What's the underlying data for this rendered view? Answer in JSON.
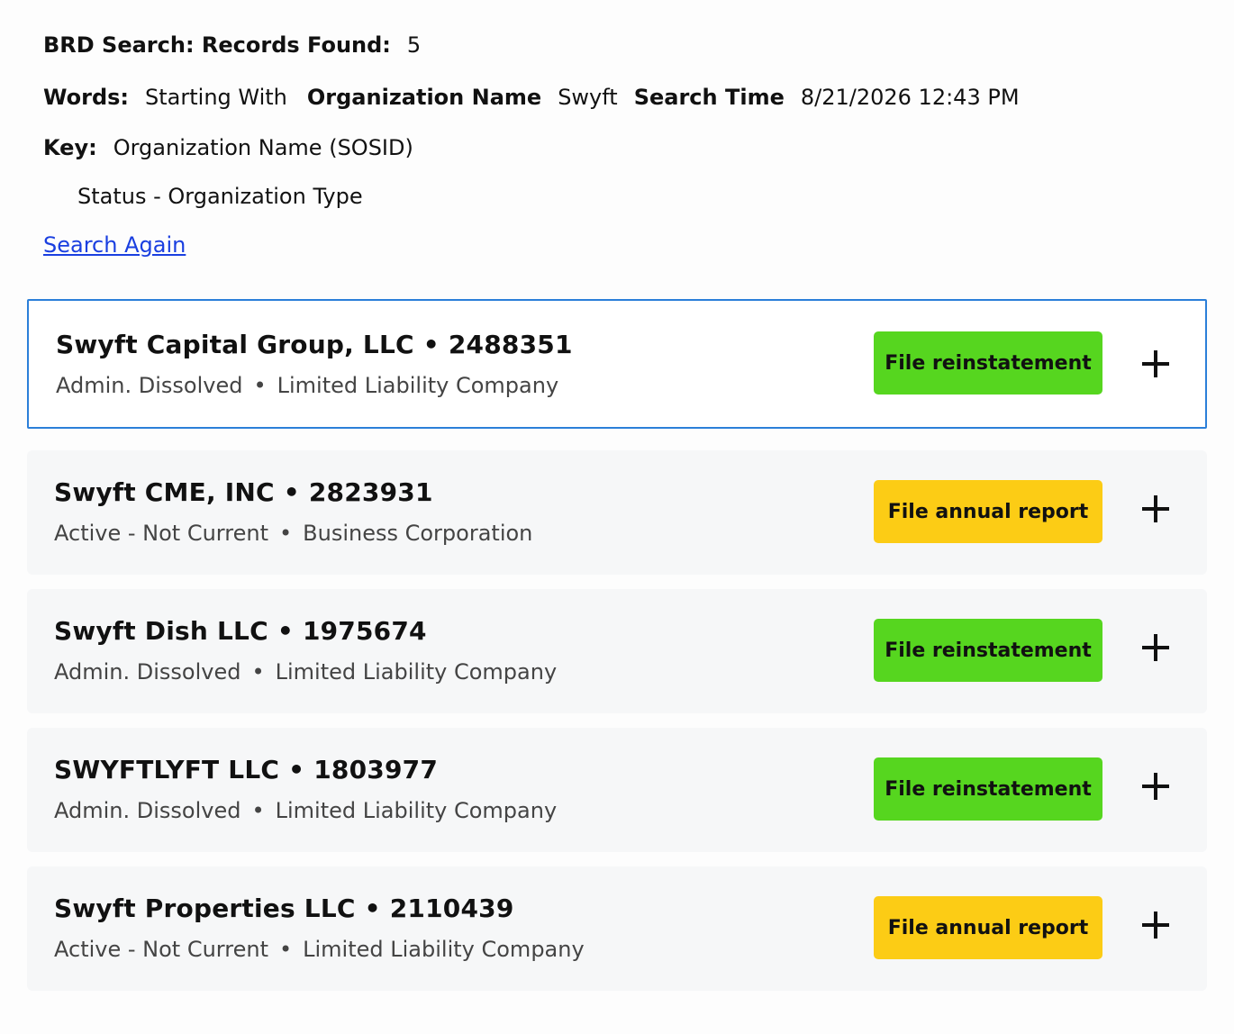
{
  "header": {
    "search_label": "BRD Search: Records Found:",
    "records_found": "5",
    "words_label": "Words:",
    "words_value": "Starting With",
    "org_name_label": "Organization Name",
    "org_name_value": "Swyft",
    "search_time_label": "Search Time",
    "search_time_value": "8/21/2026 12:43 PM",
    "key_label": "Key:",
    "key_value": "Organization Name (SOSID)",
    "key_value_2": "Status - Organization Type",
    "search_again": "Search Again"
  },
  "separator": "•",
  "results": [
    {
      "name": "Swyft Capital Group, LLC",
      "sosid": "2488351",
      "status": "Admin. Dissolved",
      "type": "Limited Liability Company",
      "action": "File reinstatement",
      "action_color": "#56d61f",
      "selected": true
    },
    {
      "name": "Swyft CME, INC",
      "sosid": "2823931",
      "status": "Active - Not Current",
      "type": "Business Corporation",
      "action": "File annual report",
      "action_color": "#fccc15",
      "selected": false
    },
    {
      "name": "Swyft Dish LLC",
      "sosid": "1975674",
      "status": "Admin. Dissolved",
      "type": "Limited Liability Company",
      "action": "File reinstatement",
      "action_color": "#56d61f",
      "selected": false
    },
    {
      "name": "SWYFTLYFT LLC",
      "sosid": "1803977",
      "status": "Admin. Dissolved",
      "type": "Limited Liability Company",
      "action": "File reinstatement",
      "action_color": "#56d61f",
      "selected": false
    },
    {
      "name": "Swyft Properties LLC",
      "sosid": "2110439",
      "status": "Active - Not Current",
      "type": "Limited Liability Company",
      "action": "File annual report",
      "action_color": "#fccc15",
      "selected": false
    }
  ]
}
